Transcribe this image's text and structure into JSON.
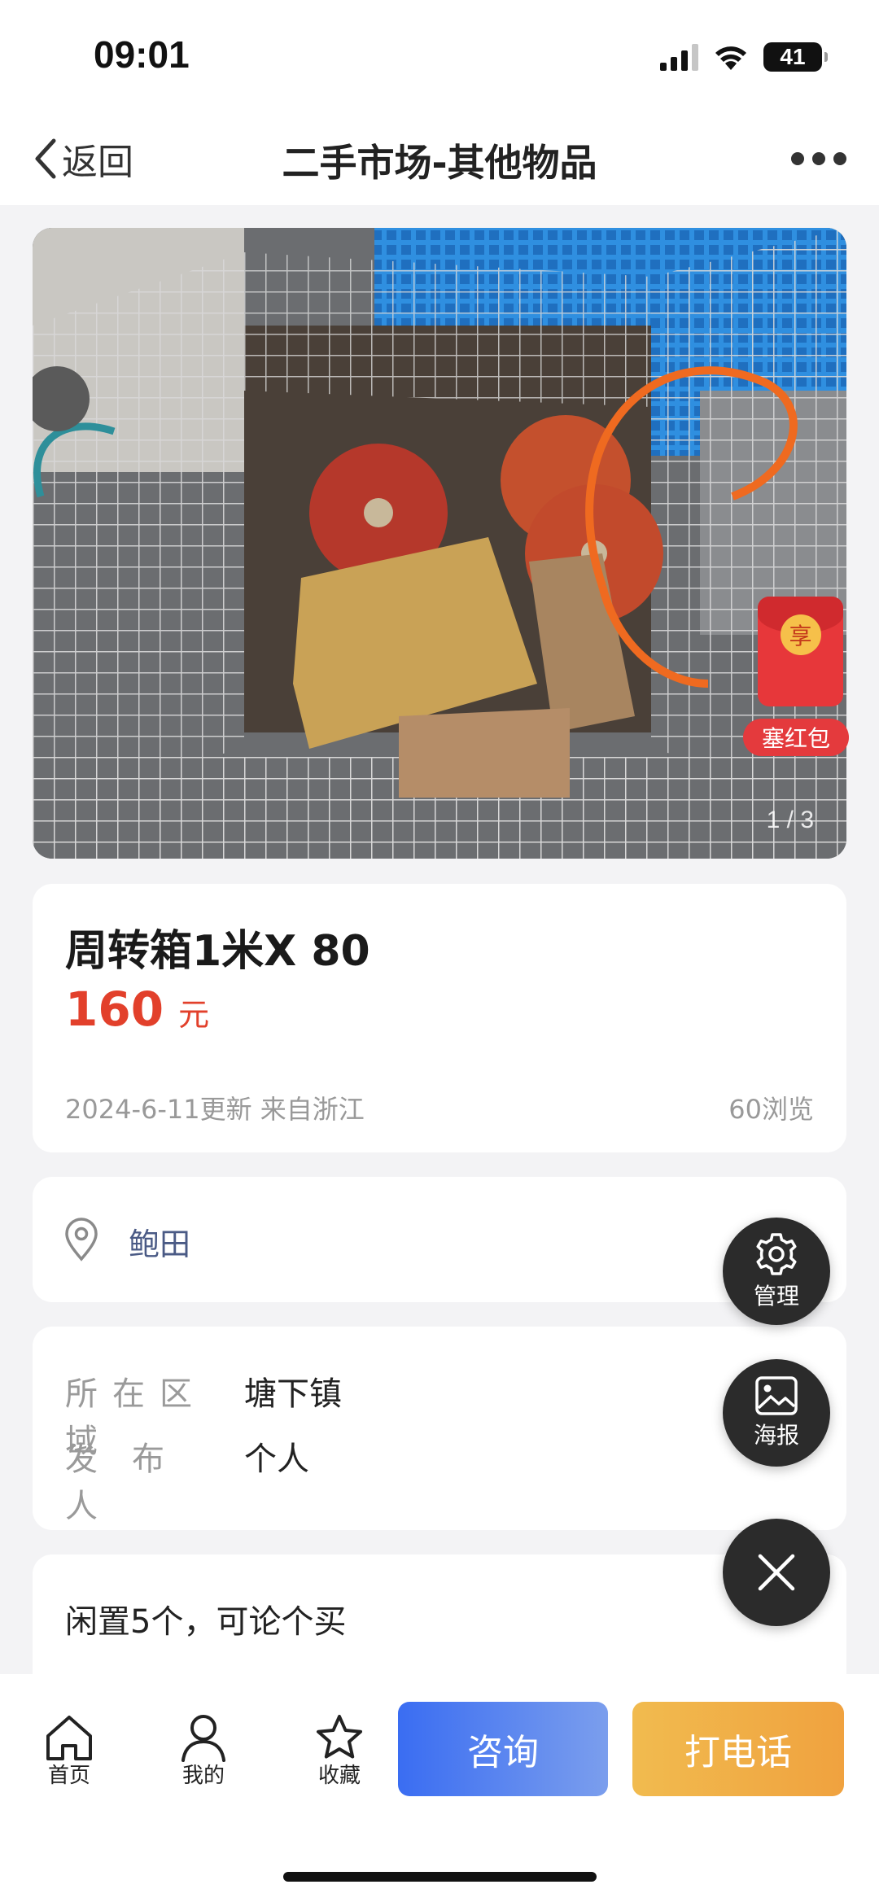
{
  "status_bar": {
    "time": "09:01",
    "battery": "41"
  },
  "nav": {
    "back_label": "返回",
    "title": "二手市场-其他物品"
  },
  "photo": {
    "counter": "1 / 3",
    "description_icon": "product-photo"
  },
  "red_packet": {
    "coin_text": "享",
    "label": "塞红包"
  },
  "listing": {
    "title": "周转箱1米X 80",
    "price": "160",
    "price_unit": "元",
    "meta_left": "2024-6-11更新 来自浙江",
    "views": "60浏览"
  },
  "location": {
    "text": "鲍田"
  },
  "details": {
    "area_key": "所在区域",
    "area_value": "塘下镇",
    "publisher_key": "发布人",
    "publisher_value": "个人"
  },
  "description": {
    "text": "闲置5个，可论个买"
  },
  "fabs": {
    "manage": "管理",
    "poster": "海报"
  },
  "tabbar": {
    "home": "首页",
    "mine": "我的",
    "favorite": "收藏",
    "consult": "咨询",
    "call": "打电话"
  },
  "colors": {
    "price": "#e2402b",
    "consult_button": "#3a6df2",
    "call_button": "#f0a23f",
    "red_packet": "#e7373a",
    "location_text": "#4a5a85"
  }
}
